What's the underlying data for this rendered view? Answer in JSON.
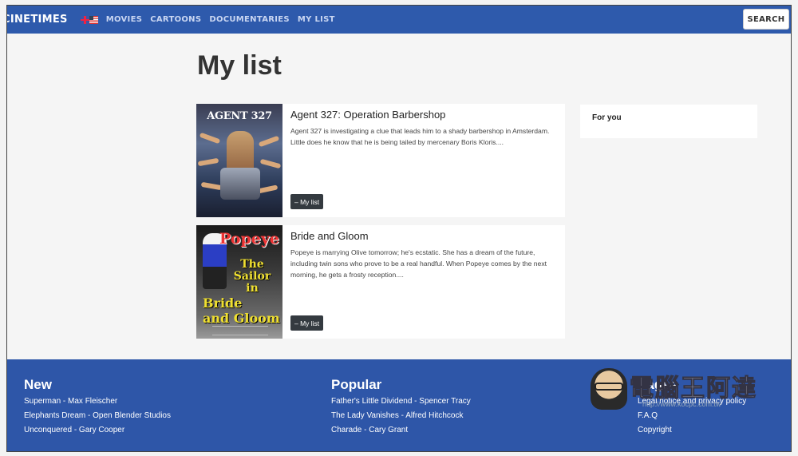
{
  "nav": {
    "brand": "CINETIMES",
    "links": [
      "MOVIES",
      "CARTOONS",
      "DOCUMENTARIES",
      "MY LIST"
    ],
    "search_label": "SEARCH"
  },
  "main": {
    "title": "My list",
    "items": [
      {
        "poster_text": "AGENT 327",
        "title": "Agent 327: Operation Barbershop",
        "description": "Agent 327 is investigating a clue that leads him to a shady barbershop in Amsterdam. Little does he know that he is being tailed by mercenary Boris Kloris....",
        "button": "– My list"
      },
      {
        "poster_text": "Popeye",
        "poster_sub": "The Sailor in",
        "poster_title_line1": "Bride",
        "poster_title_line2": "and Gloom",
        "title": "Bride and Gloom",
        "description": "Popeye is marrying Olive tomorrow; he's ecstatic. She has a dream of the future, including twin sons who prove to be a real handful. When Popeye comes by the next morning, he gets a frosty reception....",
        "button": "– My list"
      }
    ],
    "for_you": "For you"
  },
  "footer": {
    "new": {
      "heading": "New",
      "links": [
        "Superman - Max Fleischer",
        "Elephants Dream - Open Blender Studios",
        "Unconquered - Gary Cooper"
      ]
    },
    "popular": {
      "heading": "Popular",
      "links": [
        "Father's Little Dividend - Spencer Tracy",
        "The Lady Vanishes - Alfred Hitchcock",
        "Charade - Cary Grant"
      ]
    },
    "pages": {
      "heading": "Pages",
      "links": [
        "Legal notice and privacy policy",
        "F.A.Q",
        "Copyright"
      ]
    }
  },
  "watermark": {
    "text": "電腦王阿達",
    "url": "http://www.kocpc.com.tw"
  }
}
